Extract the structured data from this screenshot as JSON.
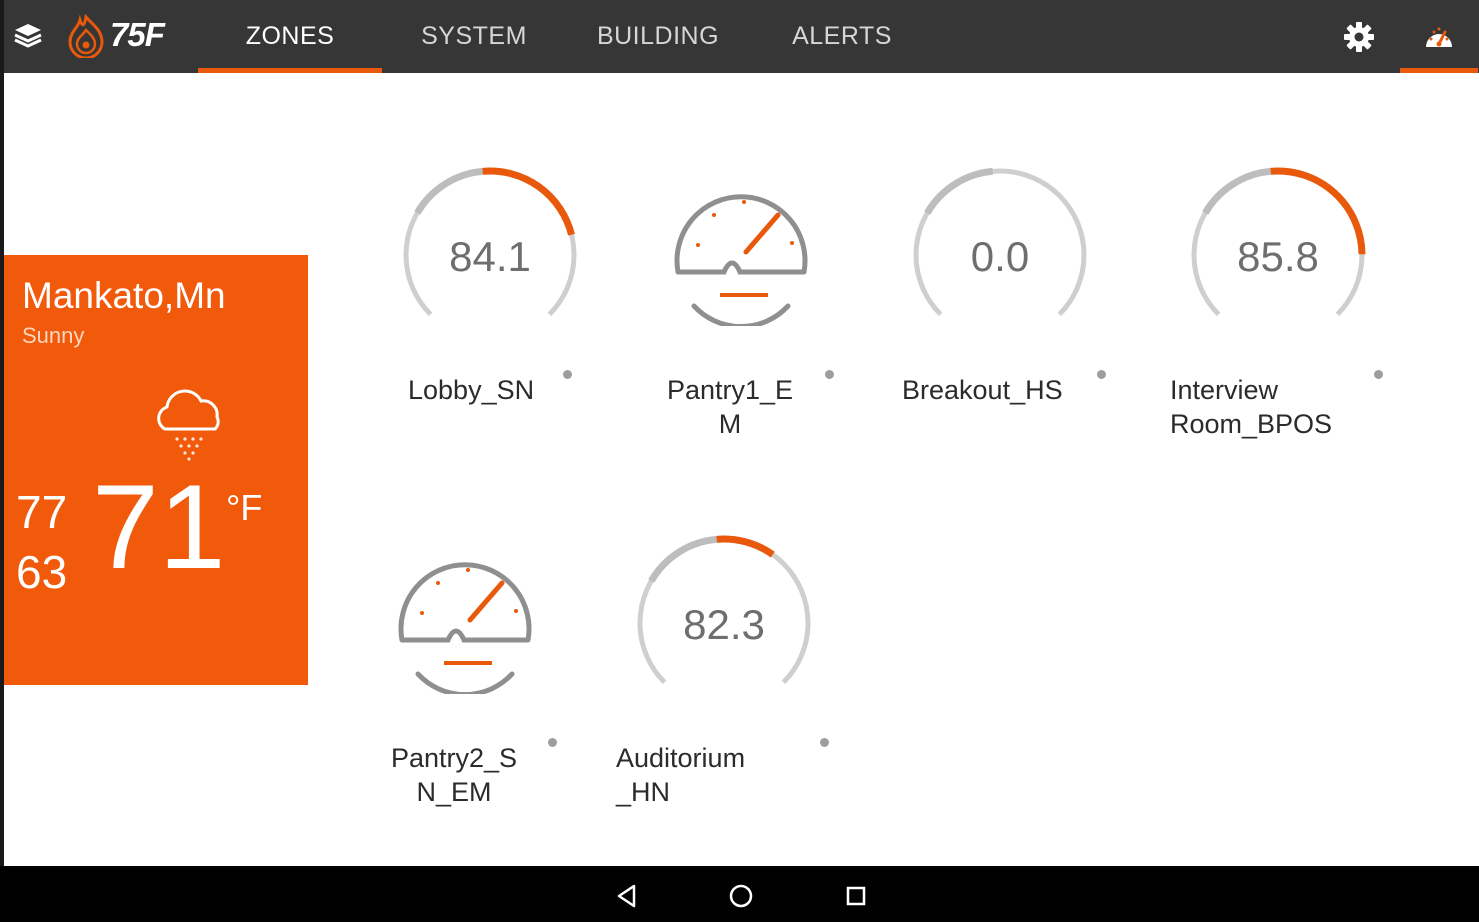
{
  "header": {
    "brand": "75F",
    "tabs": [
      {
        "label": "ZONES",
        "active": true
      },
      {
        "label": "SYSTEM",
        "active": false
      },
      {
        "label": "BUILDING",
        "active": false
      },
      {
        "label": "ALERTS",
        "active": false
      }
    ],
    "icons": [
      "layers-icon",
      "gear-icon",
      "dashboard-icon"
    ]
  },
  "weather": {
    "city": "Mankato,Mn",
    "condition": "Sunny",
    "high": "77",
    "low": "63",
    "current": "71",
    "unit": "°F",
    "icon": "cloud-snow-icon"
  },
  "zones": [
    {
      "name": "Lobby_SN",
      "value": "84.1",
      "type": "gauge",
      "progress": 0.3
    },
    {
      "name_line1": "Pantry1_E",
      "name_line2": "M",
      "type": "energy-meter"
    },
    {
      "name": "Breakout_HS",
      "value": "0.0",
      "type": "gauge",
      "progress": 0.0
    },
    {
      "name_line1": "Interview",
      "name_line2": "Room_BPOS",
      "value": "85.8",
      "type": "gauge",
      "progress": 0.35
    },
    {
      "name_line1": "Pantry2_S",
      "name_line2": "N_EM",
      "type": "energy-meter"
    },
    {
      "name_line1": "Auditorium",
      "name_line2": "_HN",
      "value": "82.3",
      "type": "gauge",
      "progress": 0.15
    }
  ],
  "colors": {
    "accent": "#f05a0a",
    "header_bg": "#363636",
    "gauge_track": "#cfcfcf",
    "gauge_fill": "#e8590c"
  },
  "system_nav": [
    "back-icon",
    "home-icon",
    "recents-icon"
  ]
}
